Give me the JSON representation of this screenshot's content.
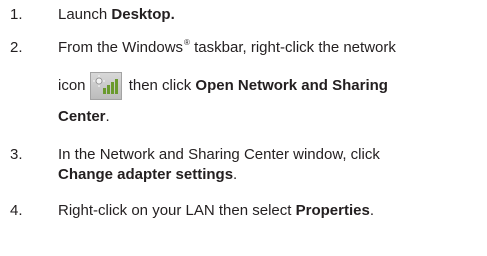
{
  "steps": [
    {
      "number": "1.",
      "pre": "Launch ",
      "bold": "Desktop."
    },
    {
      "number": "2.",
      "line1_pre": "From the Windows",
      "line1_sup": "®",
      "line1_post": " taskbar, right-click the network",
      "line2_pre": "icon",
      "icon": "network-signal-icon",
      "line2_post": " then click ",
      "line2_bold": "Open Network and Sharing",
      "line3_bold": "Center",
      "line3_post": "."
    },
    {
      "number": "3.",
      "line1": "In the Network and Sharing Center window, click",
      "line2_bold": "Change adapter settings",
      "line2_post": "."
    },
    {
      "number": "4.",
      "pre": "Right-click on your LAN then select ",
      "bold": "Properties",
      "post": "."
    }
  ],
  "colors": {
    "text": "#231f20",
    "icon_bg": "#c9c9c9",
    "icon_bars": "#6a9a2e"
  }
}
